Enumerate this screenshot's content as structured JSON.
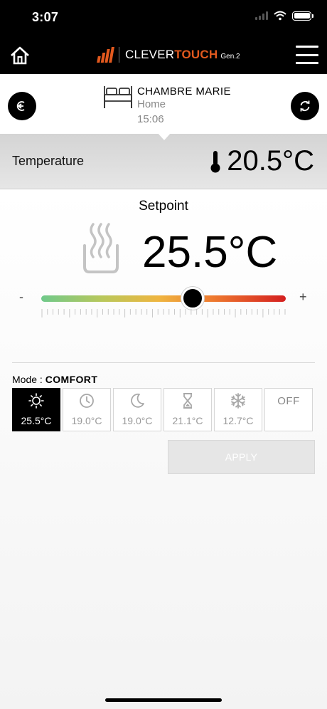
{
  "status_bar": {
    "time": "3:07"
  },
  "header": {
    "brand_prefix": "CLEVER",
    "brand_suffix": "TOUCH",
    "brand_gen": "Gen.2"
  },
  "room": {
    "name": "CHAMBRE MARIE",
    "location": "Home",
    "time": "15:06"
  },
  "temperature": {
    "label": "Temperature",
    "value": "20.5°C"
  },
  "setpoint": {
    "title": "Setpoint",
    "value": "25.5°C",
    "minus": "-",
    "plus": "+",
    "slider_fraction": 0.62
  },
  "mode": {
    "label": "Mode : ",
    "current": "COMFORT",
    "options": [
      {
        "icon": "sun-icon",
        "temp": "25.5°C",
        "active": true
      },
      {
        "icon": "clock-icon",
        "temp": "19.0°C",
        "active": false
      },
      {
        "icon": "moon-icon",
        "temp": "19.0°C",
        "active": false
      },
      {
        "icon": "hourglass-icon",
        "temp": "21.1°C",
        "active": false
      },
      {
        "icon": "snowflake-icon",
        "temp": "12.7°C",
        "active": false
      },
      {
        "icon": "off",
        "label": "OFF",
        "active": false
      }
    ]
  },
  "apply": {
    "label": "APPLY"
  },
  "colors": {
    "brand_orange": "#e2591e",
    "active_mode": "#000000"
  }
}
